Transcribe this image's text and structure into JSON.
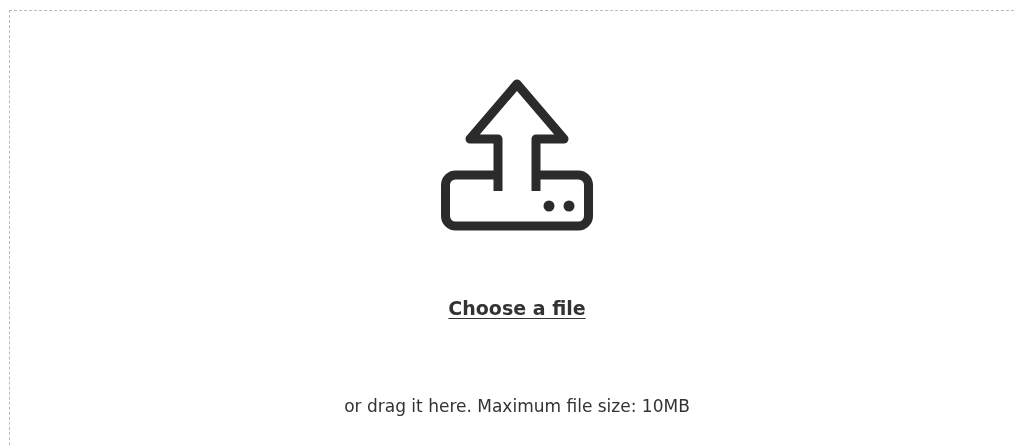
{
  "upload": {
    "link": "Choose a file",
    "hint": "or drag it here. Maximum file size: 10MB"
  }
}
